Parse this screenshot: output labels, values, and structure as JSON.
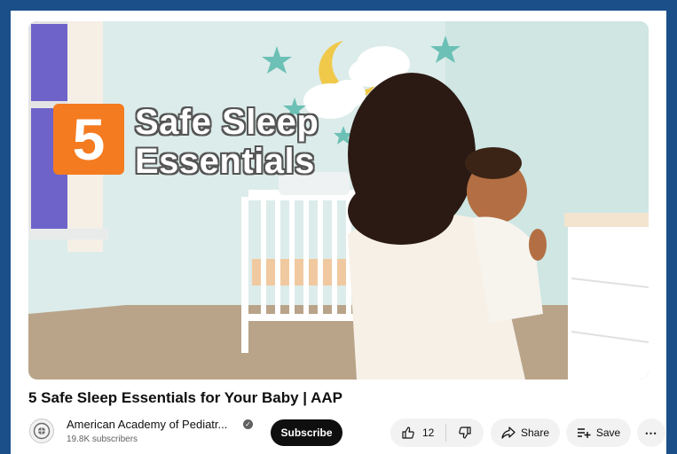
{
  "thumbnail": {
    "number": "5",
    "title_line1": "Safe Sleep",
    "title_line2": "Essentials"
  },
  "video": {
    "title": "5 Safe Sleep Essentials for Your Baby | AAP"
  },
  "channel": {
    "name": "American Academy of Pediatr...",
    "subscribers": "19.8K subscribers",
    "subscribe_label": "Subscribe"
  },
  "actions": {
    "like_count": "12",
    "share_label": "Share",
    "save_label": "Save",
    "more_label": "⋯"
  },
  "colors": {
    "frame_border": "#1b4f8a",
    "badge_orange": "#f47b20",
    "subscribe_bg": "#0f0f0f"
  }
}
